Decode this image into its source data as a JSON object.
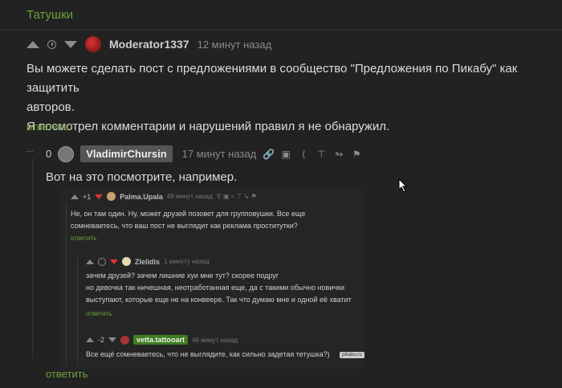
{
  "tag": "Татушки",
  "comment1": {
    "author": "Moderator1337",
    "time": "12 минут назад",
    "lines": [
      "Вы можете сделать пост с предложениями в сообщество \"Предложения по Пикабу\" как защитить",
      "авторов.",
      "Я посмотрел комментарии и нарушений правил я не обнаружил."
    ],
    "reply": "ответить"
  },
  "comment2": {
    "rating": "0",
    "author": "VladimirChursin",
    "time": "17 минут назад",
    "text": "Вот на это посмотрите, например.",
    "reply": "ответить",
    "toolbar_icons": [
      "link-icon",
      "save-icon",
      "share-icon",
      "pin-icon",
      "flag-small-icon",
      "report-flag-icon"
    ]
  },
  "screenshot": {
    "c1": {
      "rating": "+1",
      "author": "Palma.Upala",
      "time": "49 минут назад",
      "lines": [
        "Не, он там один. Ну, может друзей позовет для групповушки. Все еще",
        "сомневаетесь, что ваш пост не выглядит как реклама проститутки?"
      ],
      "reply": "ответить"
    },
    "c2": {
      "author": "Zlelidis",
      "time": "1 минуту назад",
      "lines": [
        "зачем друзей? зачем лишние хуи мне тут? скорее подруг",
        "но девочка так ничешная, неотработанная еще, да с такими обычно новички",
        "выступают, которые еще не на конвеере. Так что думаю мне и одной её хватит"
      ],
      "reply": "ответить"
    },
    "c3": {
      "rating": "-2",
      "author": "vetta.tattooart",
      "time": "46 минут назад",
      "text": "Все ещё сомневаетесь, что не выглядите, как сильно задетая тетушка?)",
      "watermark": "pikabu.ru"
    }
  },
  "bottom_reply": "ответить"
}
